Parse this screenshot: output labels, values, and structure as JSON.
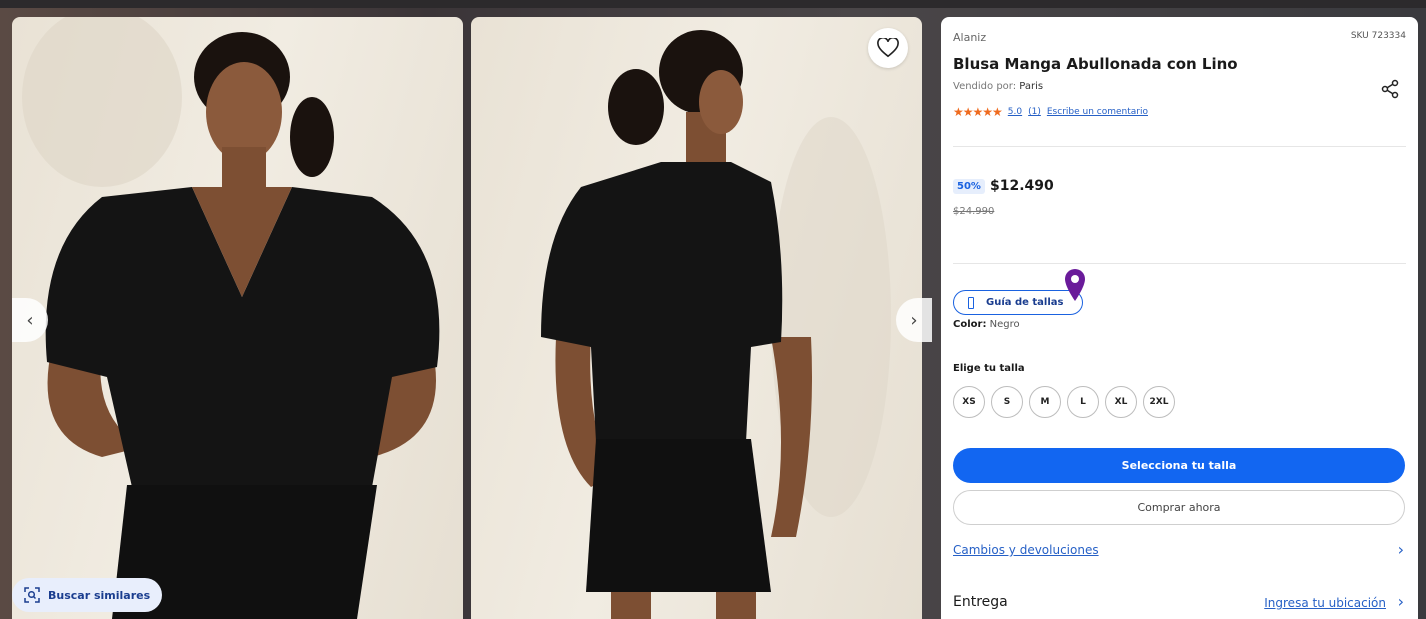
{
  "gallery": {
    "prev_label": "‹",
    "next_label": "›",
    "similar_label": "Buscar similares",
    "favorite_icon": "heart-outline-icon",
    "similar_icon": "image-search-icon"
  },
  "product": {
    "brand": "Alaniz",
    "sku": "SKU 723334",
    "title": "Blusa Manga Abullonada con Lino",
    "seller_prefix": "Vendido por:",
    "seller": "Paris",
    "stars": "★★★★★",
    "rating_value": "5.0",
    "rating_count": "(1)",
    "review_link": "Escribe un comentario",
    "discount": "50%",
    "price": "$12.490",
    "old_price": "$24.990"
  },
  "options": {
    "size_guide": "Guía de tallas",
    "color_label": "Color:",
    "color_value": "Negro",
    "size_heading": "Elige tu talla",
    "sizes": [
      "XS",
      "S",
      "M",
      "L",
      "XL",
      "2XL"
    ]
  },
  "actions": {
    "select_size": "Selecciona tu talla",
    "buy_now": "Comprar ahora",
    "returns": "Cambios y devoluciones",
    "chevron": "›",
    "delivery": "Entrega",
    "location": "Ingresa tu ubicación"
  },
  "colors": {
    "primary": "#1266f1",
    "link": "#2660c6",
    "star": "#ef6b1f",
    "pin": "#6a1b9a"
  }
}
